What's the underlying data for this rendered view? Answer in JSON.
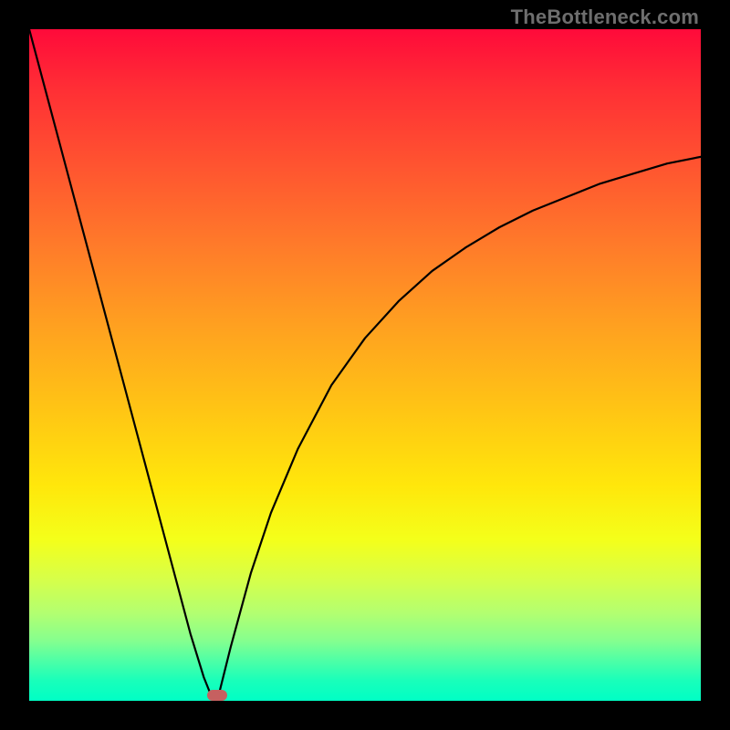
{
  "watermark": "TheBottleneck.com",
  "chart_data": {
    "type": "line",
    "title": "",
    "xlabel": "",
    "ylabel": "",
    "xlim": [
      0,
      100
    ],
    "ylim": [
      0,
      100
    ],
    "grid": false,
    "legend": false,
    "series": [
      {
        "name": "left-branch",
        "x": [
          0,
          2,
          4,
          6,
          8,
          10,
          12,
          14,
          16,
          18,
          20,
          22,
          24,
          26,
          27,
          28
        ],
        "values": [
          100,
          92.5,
          85,
          77.5,
          70,
          62.5,
          55,
          47.5,
          40,
          32.5,
          25,
          17.5,
          10,
          3.5,
          1,
          0
        ]
      },
      {
        "name": "right-branch",
        "x": [
          28,
          30,
          33,
          36,
          40,
          45,
          50,
          55,
          60,
          65,
          70,
          75,
          80,
          85,
          90,
          95,
          100
        ],
        "values": [
          0,
          8,
          19,
          28,
          37.5,
          47,
          54,
          59.5,
          64,
          67.5,
          70.5,
          73,
          75,
          77,
          78.5,
          80,
          81
        ]
      }
    ],
    "marker": {
      "x": 28,
      "y": 0.8,
      "color": "#c66060"
    },
    "background_gradient": {
      "top": "#ff0a3a",
      "bottom": "#00ffc5"
    }
  },
  "frame": {
    "border_px": 32,
    "border_color": "#000000"
  }
}
